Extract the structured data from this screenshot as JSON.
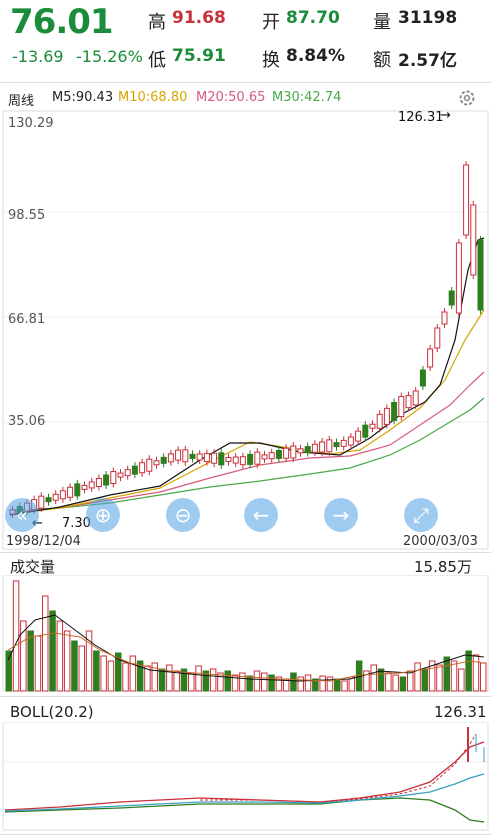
{
  "header": {
    "price": "76.01",
    "change": "-13.69",
    "change_pct": "-15.26%",
    "high_label": "高",
    "high": "91.68",
    "low_label": "低",
    "low": "75.91",
    "open_label": "开",
    "open": "87.70",
    "turnover_label": "换",
    "turnover": "8.84%",
    "volume_label": "量",
    "volume": "31198",
    "amount_label": "额",
    "amount": "2.57亿"
  },
  "ma_bar": {
    "period": "周线",
    "ma5": "M5:90.43",
    "ma10": "M10:68.80",
    "ma20": "M20:50.65",
    "ma30": "M30:42.74",
    "settings_icon": "gear-icon"
  },
  "price_chart": {
    "y_ticks": [
      "130.29",
      "98.55",
      "66.81",
      "35.06"
    ],
    "max_marker": "126.31",
    "min_marker": "7.30",
    "date_start": "1998/12/04",
    "date_end": "2000/03/03"
  },
  "nav_buttons": [
    "rewind-icon",
    "zoom-in-icon",
    "zoom-out-icon",
    "arrow-left-icon",
    "arrow-right-icon",
    "fullscreen-icon"
  ],
  "volume_panel": {
    "title": "成交量",
    "max": "15.85万"
  },
  "boll_panel": {
    "title": "BOLL(20.2)",
    "max": "126.31"
  },
  "colors": {
    "up": "#c8303a",
    "down": "#2e7d1e",
    "ma5": "#111111",
    "ma10": "#d7a500",
    "ma20": "#d65a7a",
    "ma30": "#4aa84a",
    "price_green": "#1a8c3a"
  }
}
